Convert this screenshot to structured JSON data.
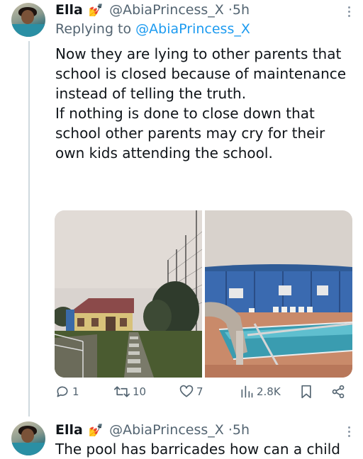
{
  "tweet": {
    "author_name": "Ella",
    "author_emoji": "💅",
    "handle": "@AbiaPrincess_X",
    "separator": "·",
    "time": "5h",
    "replying_to_label": "Replying to",
    "replying_to_handle": "@AbiaPrincess_X",
    "text_lines": [
      "Now they are lying to other parents that school is closed because of maintenance instead of telling the truth.",
      "If nothing is done to close down that school other parents may cry for their own kids attending the school."
    ],
    "media": [
      {
        "icon": "school-building-photo"
      },
      {
        "icon": "swimming-pool-photo"
      }
    ],
    "stats": {
      "replies": "1",
      "retweets": "10",
      "likes": "7",
      "views": "2.8K"
    }
  },
  "next_tweet": {
    "author_name": "Ella",
    "author_emoji": "💅",
    "handle": "@AbiaPrincess_X",
    "separator": "·",
    "time": "5h",
    "text_partial": "The pool has barricades how can a child"
  },
  "colors": {
    "text": "#0f1419",
    "secondary": "#536471",
    "link": "#1d9bf0",
    "thread_line": "#cfd9de"
  }
}
